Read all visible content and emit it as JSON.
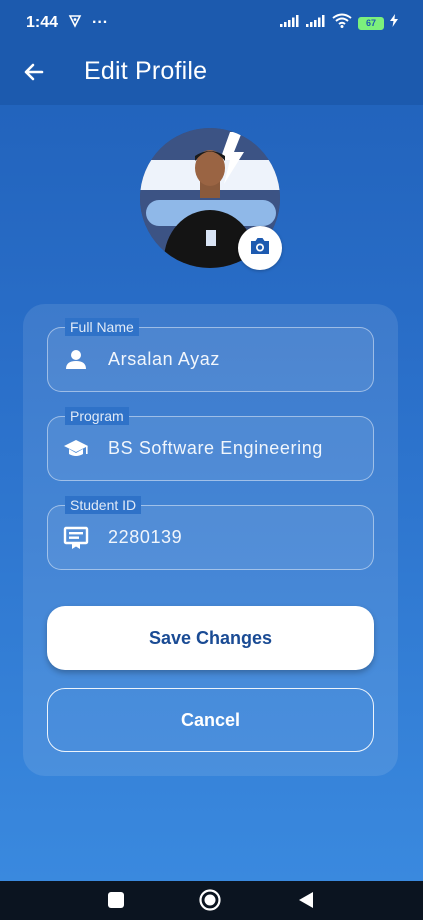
{
  "status_bar": {
    "time": "1:44",
    "more": "···",
    "battery": "67"
  },
  "header": {
    "title": "Edit Profile"
  },
  "form": {
    "fields": [
      {
        "label": "Full Name",
        "value": "Arsalan Ayaz",
        "icon": "person-icon"
      },
      {
        "label": "Program",
        "value": "BS Software Engineering",
        "icon": "school-icon"
      },
      {
        "label": "Student ID",
        "value": "2280139",
        "icon": "badge-icon"
      }
    ]
  },
  "actions": {
    "save_label": "Save Changes",
    "cancel_label": "Cancel"
  },
  "colors": {
    "app_bar": "#1c5aae",
    "background_top": "#1f5fb8",
    "background_bottom": "#3b8be0",
    "save_text": "#1a4b94"
  }
}
